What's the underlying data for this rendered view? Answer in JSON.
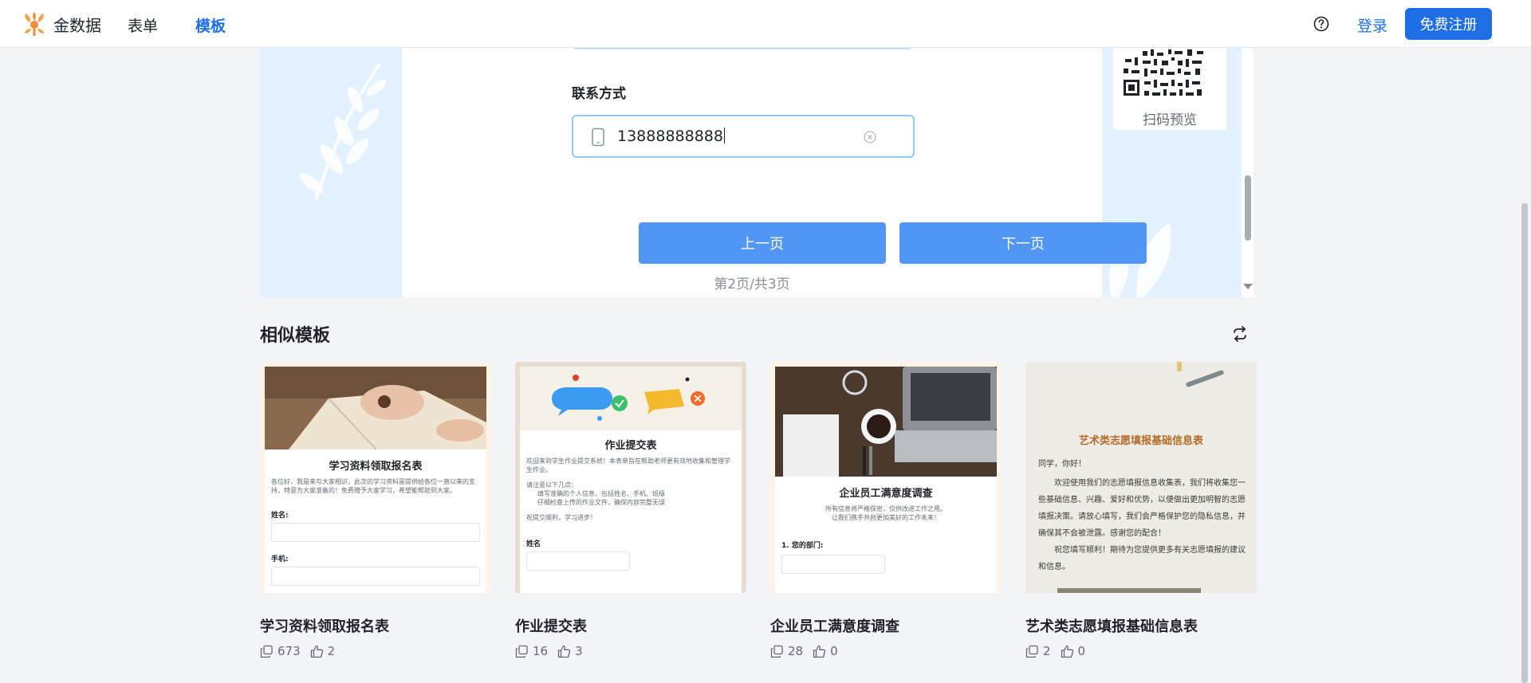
{
  "nav": {
    "brand": "金数据",
    "items": [
      {
        "label": "表单",
        "active": false
      },
      {
        "label": "模板",
        "active": true
      }
    ],
    "login": "登录",
    "register": "免费注册",
    "help_icon": "question-circle-icon",
    "accent_color": "#1e6fe6"
  },
  "preview": {
    "field_label": "联系方式",
    "phone_value": "13888888888",
    "prev_button": "上一页",
    "next_button": "下一页",
    "page_info": "第2页/共3页",
    "qr_caption": "扫码预览",
    "button_color": "#5196f3"
  },
  "similar": {
    "title": "相似模板",
    "refresh_icon": "swap-icon",
    "cards": [
      {
        "title": "学习资料领取报名表",
        "copies": "673",
        "likes": "2",
        "thumb": {
          "heading": "学习资料领取报名表",
          "intro": "各位好，我是来与大家相识，此次的学习资料是提供给各位一直以来的支持，特意为大家准备的！免费赠予大家学习，希望能帮助到大家。",
          "field1": "姓名:",
          "field2": "手机:"
        }
      },
      {
        "title": "作业提交表",
        "copies": "16",
        "likes": "3",
        "thumb": {
          "heading": "作业提交表",
          "intro": "欢迎来到学生作业提交系统！本表单旨在帮助老师更有效地收集和管理学生作业。",
          "notice": "请注意以下几点：",
          "bullet1": "填写准确的个人信息，包括姓名、手机、班级",
          "bullet2": "仔细检查上传的作业文件，确保内容完整无误",
          "closing": "祝提交顺利，学习进步！",
          "field1": "姓名"
        }
      },
      {
        "title": "企业员工满意度调查",
        "copies": "28",
        "likes": "0",
        "thumb": {
          "heading": "企业员工满意度调查",
          "intro1": "所有信息将严格保密，仅供改进工作之用。",
          "intro2": "让我们携手共创更加美好的工作未来！",
          "field1": "1. 您的部门:"
        }
      },
      {
        "title": "艺术类志愿填报基础信息表",
        "copies": "2",
        "likes": "0",
        "thumb": {
          "heading": "艺术类志愿填报基础信息表",
          "greeting": "同学，你好！",
          "para1": "欢迎使用我们的志愿填报信息收集表，我们将收集您一些基础信息、兴趣、爱好和优势，以便做出更加明智的志愿填报决策。请放心填写，我们会严格保护您的隐私信息，并确保其不会被泄露。感谢您的配合！",
          "para2": "祝您填写顺利！期待为您提供更多有关志愿填报的建议和信息。"
        }
      }
    ]
  }
}
